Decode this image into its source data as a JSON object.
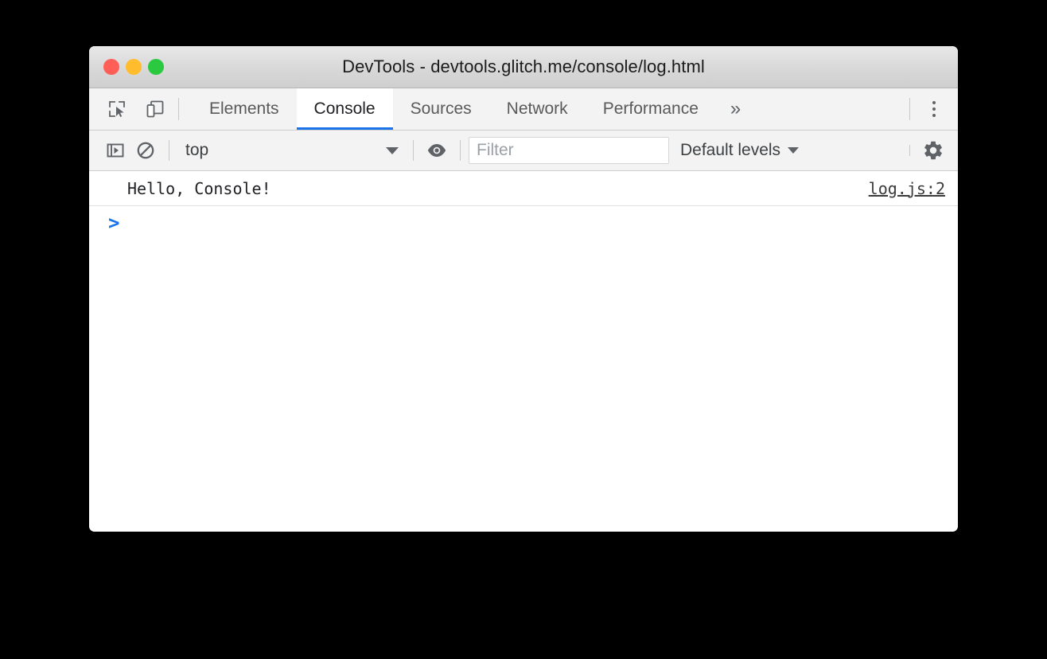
{
  "window": {
    "title": "DevTools - devtools.glitch.me/console/log.html",
    "traffic_lights": [
      {
        "name": "close",
        "color": "#ff5f56"
      },
      {
        "name": "minimize",
        "color": "#ffbd2e"
      },
      {
        "name": "zoom",
        "color": "#2ac940"
      }
    ]
  },
  "tabstrip": {
    "icons": [
      {
        "name": "inspect-element-icon"
      },
      {
        "name": "device-toolbar-icon"
      }
    ],
    "tabs": [
      {
        "label": "Elements",
        "active": false
      },
      {
        "label": "Console",
        "active": true
      },
      {
        "label": "Sources",
        "active": false
      },
      {
        "label": "Network",
        "active": false
      },
      {
        "label": "Performance",
        "active": false
      }
    ],
    "more_tabs_label": "»",
    "main_menu_label": "Customize and control DevTools",
    "accent_color": "#1a73e8"
  },
  "console_toolbar": {
    "sidebar_toggle_label": "Show console sidebar",
    "clear_label": "Clear console",
    "context": {
      "value": "top",
      "caret": "▼"
    },
    "eye_label": "Create live expression",
    "filter": {
      "value": "",
      "placeholder": "Filter"
    },
    "levels": {
      "label": "Default levels",
      "caret": "▼"
    },
    "settings_label": "Console settings"
  },
  "console": {
    "messages": [
      {
        "text": "Hello, Console!",
        "source": "log.js:2"
      }
    ],
    "prompt": ">"
  }
}
